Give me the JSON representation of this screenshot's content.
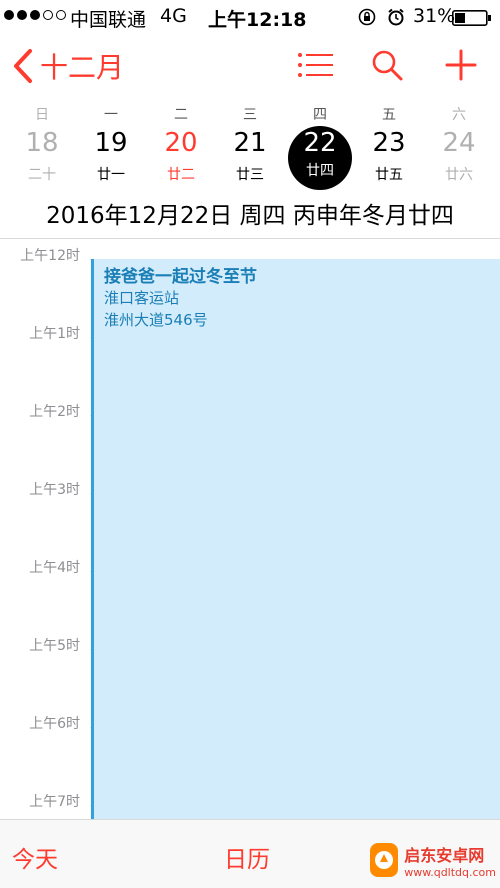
{
  "status_bar": {
    "carrier": "中国联通",
    "network": "4G",
    "time": "上午12:18",
    "battery": "31%"
  },
  "nav": {
    "back_label": "十二月",
    "icons": [
      "back-chevron-icon",
      "list-icon",
      "search-icon",
      "add-icon"
    ],
    "accent_color": "#ff3b30"
  },
  "week": {
    "days_of_week": [
      "日",
      "一",
      "二",
      "三",
      "四",
      "五",
      "六"
    ],
    "days": [
      {
        "num": "18",
        "lunar": "二十"
      },
      {
        "num": "19",
        "lunar": "廿一"
      },
      {
        "num": "20",
        "lunar": "廿二"
      },
      {
        "num": "21",
        "lunar": "廿三"
      },
      {
        "num": "22",
        "lunar": "廿四"
      },
      {
        "num": "23",
        "lunar": "廿五"
      },
      {
        "num": "24",
        "lunar": "廿六"
      }
    ]
  },
  "date_line": "2016年12月22日 周四   丙申年冬月廿四",
  "timeline": {
    "hours": [
      "上午12时",
      "上午1时",
      "上午2时",
      "上午3时",
      "上午4时",
      "上午5时",
      "上午6时",
      "上午7时"
    ]
  },
  "event": {
    "title": "接爸爸一起过冬至节",
    "location_line1": "淮口客运站",
    "location_line2": "淮州大道546号",
    "color": "#d2ecfb"
  },
  "bottom": {
    "today": "今天",
    "calendars": "日历"
  },
  "watermark": {
    "line1": "启东安卓网",
    "line2": "www.qdltdq.com"
  }
}
